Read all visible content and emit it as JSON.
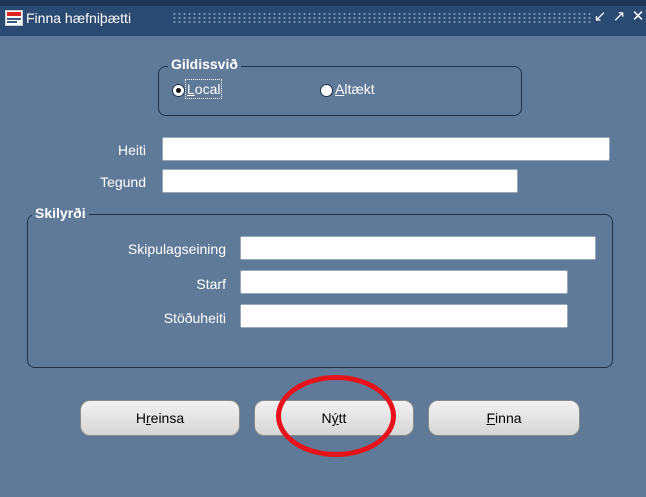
{
  "window": {
    "title": "Finna hæfniþætti",
    "controls": [
      "minimize-icon",
      "maximize-icon",
      "close-icon"
    ]
  },
  "scope": {
    "title": "Gildissvið",
    "options": [
      {
        "label": "Local",
        "mnemonic": "L",
        "rest": "ocal",
        "selected": true
      },
      {
        "label": "Altækt",
        "mnemonic": "A",
        "rest": "ltækt",
        "selected": false
      }
    ]
  },
  "fields": {
    "name": {
      "label": "Heiti",
      "value": ""
    },
    "type": {
      "label": "Tegund",
      "value": ""
    }
  },
  "conditions": {
    "title": "Skilyrði",
    "org_unit": {
      "label": "Skipulagseining",
      "value": ""
    },
    "job": {
      "label": "Starf",
      "value": ""
    },
    "position": {
      "label": "Stöðuheiti",
      "value": ""
    }
  },
  "buttons": {
    "clear": {
      "pre": "H",
      "mnemonic": "r",
      "post": "einsa",
      "label": "Hreinsa"
    },
    "new": {
      "pre": "N",
      "mnemonic": "ý",
      "post": "tt",
      "label": "Nýtt"
    },
    "find": {
      "pre": "",
      "mnemonic": "F",
      "post": "inna",
      "label": "Finna"
    }
  },
  "colors": {
    "background": "#5f7a98",
    "titlebar": "#2a4a72",
    "highlight_circle": "#e6141a"
  }
}
